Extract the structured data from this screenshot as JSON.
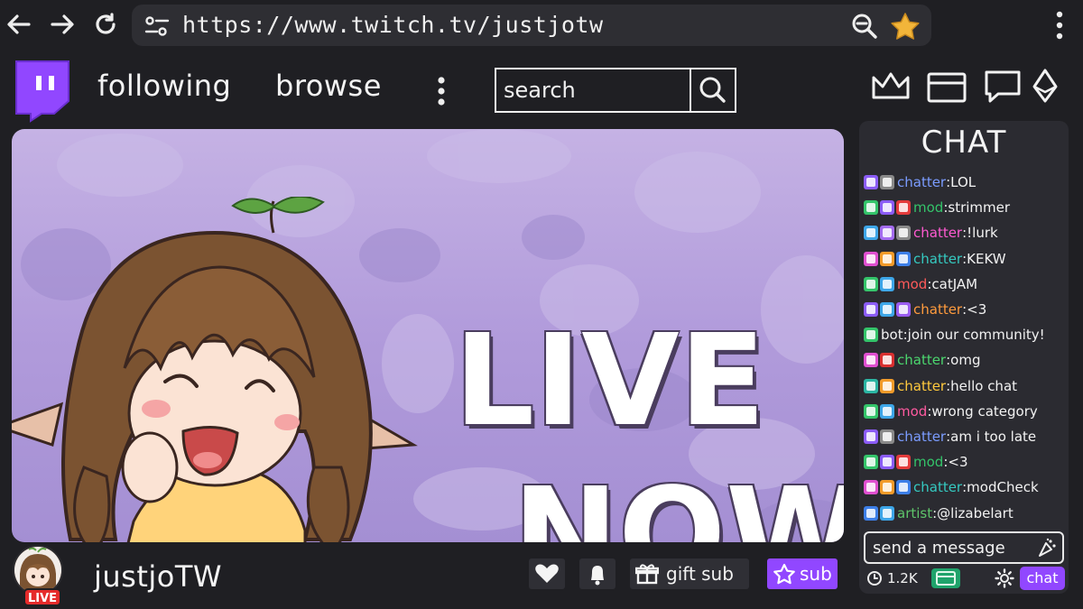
{
  "browser": {
    "url": "https://www.twitch.tv/justjotw",
    "icons": [
      "back-arrow-icon",
      "forward-arrow-icon",
      "refresh-icon",
      "site-settings-icon",
      "zoom-out-icon",
      "bookmark-star-icon",
      "more-vertical-icon"
    ]
  },
  "header": {
    "nav": [
      {
        "label": "following"
      },
      {
        "label": "browse"
      }
    ],
    "search": {
      "placeholder": "search"
    },
    "icons": [
      "crown-icon",
      "inbox-icon",
      "chat-bubble-icon",
      "bits-icon"
    ]
  },
  "stream": {
    "overlay_line1": "LIVE",
    "overlay_line2": "NOW"
  },
  "channel": {
    "name": "justjoTW",
    "live_badge": "LIVE",
    "gift_label": "gift sub",
    "sub_label": "sub"
  },
  "chat": {
    "title": "CHAT",
    "messages": [
      {
        "badges": [
          "star",
          "gift-gray"
        ],
        "user": "chatter",
        "color": "#7b9cff",
        "text": "LOL"
      },
      {
        "badges": [
          "mod",
          "star",
          "gift-red"
        ],
        "user": "mod",
        "color": "#34c46a",
        "text": "strimmer"
      },
      {
        "badges": [
          "sub-blue",
          "gift-purple",
          "gray"
        ],
        "user": "chatter",
        "color": "#ff5ad1",
        "text": "!lurk"
      },
      {
        "badges": [
          "heart",
          "gift-orange",
          "blue"
        ],
        "user": "chatter",
        "color": "#35c9c0",
        "text": "KEKW"
      },
      {
        "badges": [
          "mod",
          "sub-blue"
        ],
        "user": "mod",
        "color": "#ff5a5a",
        "text": "catJAM"
      },
      {
        "badges": [
          "star",
          "sub-blue",
          "purple"
        ],
        "user": "chatter",
        "color": "#ff9b3d",
        "text": "<3"
      },
      {
        "badges": [
          "mod"
        ],
        "user": "bot",
        "color": "#f2f2f2",
        "text": "join our community!"
      },
      {
        "badges": [
          "heart",
          "red-x"
        ],
        "user": "chatter",
        "color": "#4bd66e",
        "text": "omg"
      },
      {
        "badges": [
          "teal",
          "gift-orange"
        ],
        "user": "chatter",
        "color": "#ffc93d",
        "text": "hello chat"
      },
      {
        "badges": [
          "mod",
          "sub-blue"
        ],
        "user": "mod",
        "color": "#ff5aa0",
        "text": "wrong category"
      },
      {
        "badges": [
          "star",
          "gift-gray"
        ],
        "user": "chatter",
        "color": "#7b9cff",
        "text": "am i too late"
      },
      {
        "badges": [
          "mod",
          "star",
          "gift-red"
        ],
        "user": "mod",
        "color": "#34c46a",
        "text": "<3"
      },
      {
        "badges": [
          "heart",
          "gift-orange",
          "blue"
        ],
        "user": "chatter",
        "color": "#35c9c0",
        "text": "modCheck"
      },
      {
        "badges": [
          "artist",
          "sub-blue"
        ],
        "user": "artist",
        "color": "#5ec46a",
        "text": "@lizabelart"
      }
    ],
    "send_placeholder": "send a message",
    "viewer_count": "1.2K",
    "chat_button": "chat"
  },
  "colors": {
    "background": "#1f1f23",
    "panel": "#2b2b31",
    "accent": "#9147ff",
    "live_red": "#e52b2b",
    "banner_purple": "#b19bdb"
  }
}
